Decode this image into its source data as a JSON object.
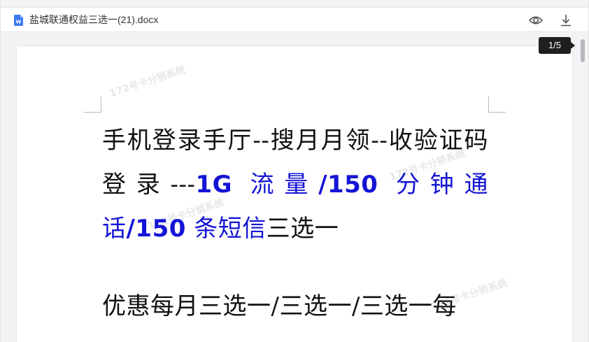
{
  "header": {
    "file_name": "盐城联通权益三选一(21).docx",
    "file_icon": "word-doc-icon",
    "icons": [
      "eye-icon",
      "download-icon"
    ]
  },
  "document": {
    "para1_start": "手机登录手厅--搜月月领--收验证码登录---",
    "para1_highlight_a": "1G",
    "para1_highlight_b": " 流量",
    "para1_highlight_c": "/150",
    "para1_highlight_d": " 分钟通话",
    "para1_highlight_e": "/150",
    "para1_highlight_f": " 条短信",
    "para1_end": "三选一",
    "para2": "优惠每月三选一/三选一/三选一每",
    "watermark": "172号卡分销系统"
  },
  "pager": {
    "label": "1/5"
  },
  "colors": {
    "highlight": "#1414d6",
    "badge": "#1f1f1f",
    "background": "#f3f3f5"
  }
}
